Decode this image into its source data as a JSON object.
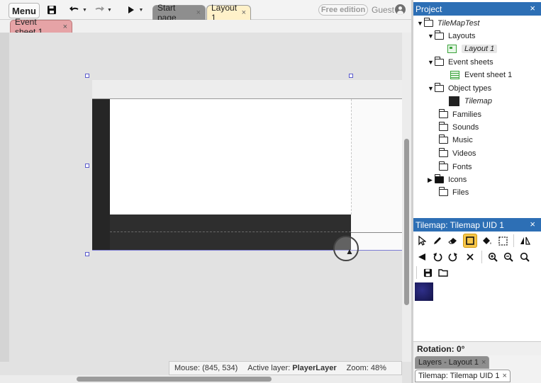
{
  "toolbar": {
    "menu_label": "Menu",
    "tabs": [
      {
        "label": "Start page",
        "close": "×"
      },
      {
        "label": "Layout 1",
        "close": "×"
      }
    ],
    "free_edition_label": "Free edition",
    "guest_label": "Guest"
  },
  "subtabs": [
    {
      "label": "Event sheet 1",
      "close": "×"
    }
  ],
  "status_bar": {
    "mouse_label": "Mouse: (845, 534)",
    "active_layer_prefix": "Active layer:",
    "active_layer_value": "PlayerLayer",
    "zoom_label": "Zoom: 48%"
  },
  "project_panel": {
    "title": "Project",
    "close": "×",
    "tree": {
      "root": "TileMapTest",
      "layouts_folder": "Layouts",
      "layout_item": "Layout 1",
      "event_sheets_folder": "Event sheets",
      "event_sheet_item": "Event sheet 1",
      "object_types_folder": "Object types",
      "object_type_item": "Tilemap",
      "families": "Families",
      "sounds": "Sounds",
      "music": "Music",
      "videos": "Videos",
      "fonts": "Fonts",
      "icons": "Icons",
      "files": "Files"
    }
  },
  "tilemap_panel": {
    "title": "Tilemap: Tilemap UID 1",
    "close": "×",
    "tools": [
      "pointer-icon",
      "pencil-icon",
      "eraser-icon",
      "rectangle-icon",
      "fill-bucket-icon",
      "selection-icon",
      "mirror-icon",
      "flip-icon",
      "rotate-left-icon",
      "rotate-right-icon",
      "reset-icon",
      "zoom-in-icon",
      "zoom-out-icon",
      "zoom-reset-icon",
      "save-icon",
      "folder-icon"
    ],
    "active_tool": "rectangle-icon",
    "rotation_label": "Rotation: 0°"
  },
  "bottom_tabs": [
    {
      "label": "Layers - Layout 1",
      "close": "×"
    },
    {
      "label": "Tilemap: Tilemap UID 1",
      "close": "×"
    }
  ],
  "colors": {
    "panel_header": "#2d6fb5",
    "active_tab": "#fff1c9",
    "event_tab": "#e6a3a6",
    "active_tool": "#f7c648",
    "selection_handles": "#5b5bcc"
  }
}
